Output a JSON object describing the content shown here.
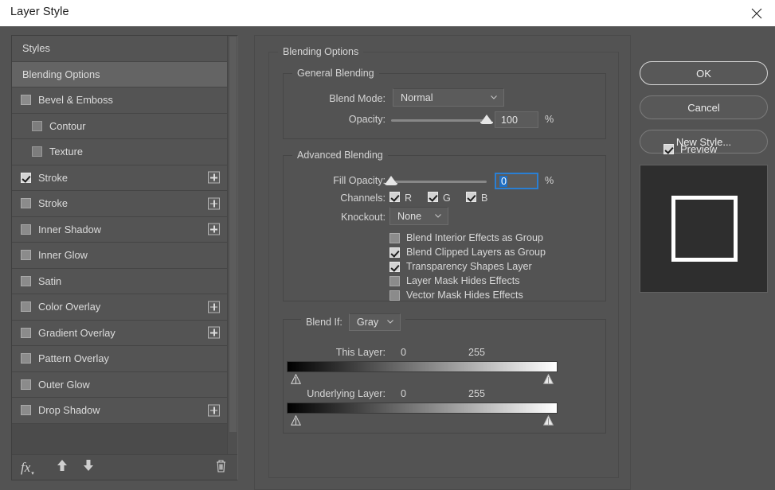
{
  "window": {
    "title": "Layer Style",
    "close_icon": "close-icon"
  },
  "sidebar": {
    "rows": [
      {
        "label": "Styles",
        "type": "header",
        "checked": false,
        "plus": false,
        "selected": false,
        "indent": 0
      },
      {
        "label": "Blending Options",
        "type": "header",
        "checked": false,
        "plus": false,
        "selected": true,
        "indent": 0
      },
      {
        "label": "Bevel & Emboss",
        "type": "check",
        "checked": false,
        "plus": false,
        "selected": false,
        "indent": 0
      },
      {
        "label": "Contour",
        "type": "check",
        "checked": false,
        "plus": false,
        "selected": false,
        "indent": 1
      },
      {
        "label": "Texture",
        "type": "check",
        "checked": false,
        "plus": false,
        "selected": false,
        "indent": 1
      },
      {
        "label": "Stroke",
        "type": "check",
        "checked": true,
        "plus": true,
        "selected": false,
        "indent": 0
      },
      {
        "label": "Stroke",
        "type": "check",
        "checked": false,
        "plus": true,
        "selected": false,
        "indent": 0
      },
      {
        "label": "Inner Shadow",
        "type": "check",
        "checked": false,
        "plus": true,
        "selected": false,
        "indent": 0
      },
      {
        "label": "Inner Glow",
        "type": "check",
        "checked": false,
        "plus": false,
        "selected": false,
        "indent": 0
      },
      {
        "label": "Satin",
        "type": "check",
        "checked": false,
        "plus": false,
        "selected": false,
        "indent": 0
      },
      {
        "label": "Color Overlay",
        "type": "check",
        "checked": false,
        "plus": true,
        "selected": false,
        "indent": 0
      },
      {
        "label": "Gradient Overlay",
        "type": "check",
        "checked": false,
        "plus": true,
        "selected": false,
        "indent": 0
      },
      {
        "label": "Pattern Overlay",
        "type": "check",
        "checked": false,
        "plus": false,
        "selected": false,
        "indent": 0
      },
      {
        "label": "Outer Glow",
        "type": "check",
        "checked": false,
        "plus": false,
        "selected": false,
        "indent": 0
      },
      {
        "label": "Drop Shadow",
        "type": "check",
        "checked": false,
        "plus": true,
        "selected": false,
        "indent": 0
      }
    ],
    "toolbar": {
      "fx_label": "fx",
      "move_up_icon": "arrow-up-icon",
      "move_down_icon": "arrow-down-icon",
      "delete_icon": "trash-icon"
    }
  },
  "main": {
    "group_title": "Blending Options",
    "general": {
      "legend": "General Blending",
      "blend_mode_label": "Blend Mode:",
      "blend_mode_value": "Normal",
      "opacity_label": "Opacity:",
      "opacity_value": "100",
      "opacity_percent": "%",
      "opacity_slider_pct": 100
    },
    "advanced": {
      "legend": "Advanced Blending",
      "fill_opacity_label": "Fill Opacity:",
      "fill_opacity_value": "0",
      "fill_opacity_percent": "%",
      "fill_opacity_slider_pct": 0,
      "channels_label": "Channels:",
      "channels": [
        {
          "label": "R",
          "checked": true
        },
        {
          "label": "G",
          "checked": true
        },
        {
          "label": "B",
          "checked": true
        }
      ],
      "knockout_label": "Knockout:",
      "knockout_value": "None",
      "options": [
        {
          "label": "Blend Interior Effects as Group",
          "checked": false
        },
        {
          "label": "Blend Clipped Layers as Group",
          "checked": true
        },
        {
          "label": "Transparency Shapes Layer",
          "checked": true
        },
        {
          "label": "Layer Mask Hides Effects",
          "checked": false
        },
        {
          "label": "Vector Mask Hides Effects",
          "checked": false
        }
      ]
    },
    "blend_if": {
      "legend_label": "Blend If:",
      "channel_value": "Gray",
      "this_layer_label": "This Layer:",
      "this_layer_min": "0",
      "this_layer_max": "255",
      "underlying_layer_label": "Underlying Layer:",
      "underlying_layer_min": "0",
      "underlying_layer_max": "255"
    }
  },
  "actions": {
    "ok_label": "OK",
    "cancel_label": "Cancel",
    "new_style_label": "New Style...",
    "preview_label": "Preview",
    "preview_checked": true
  }
}
